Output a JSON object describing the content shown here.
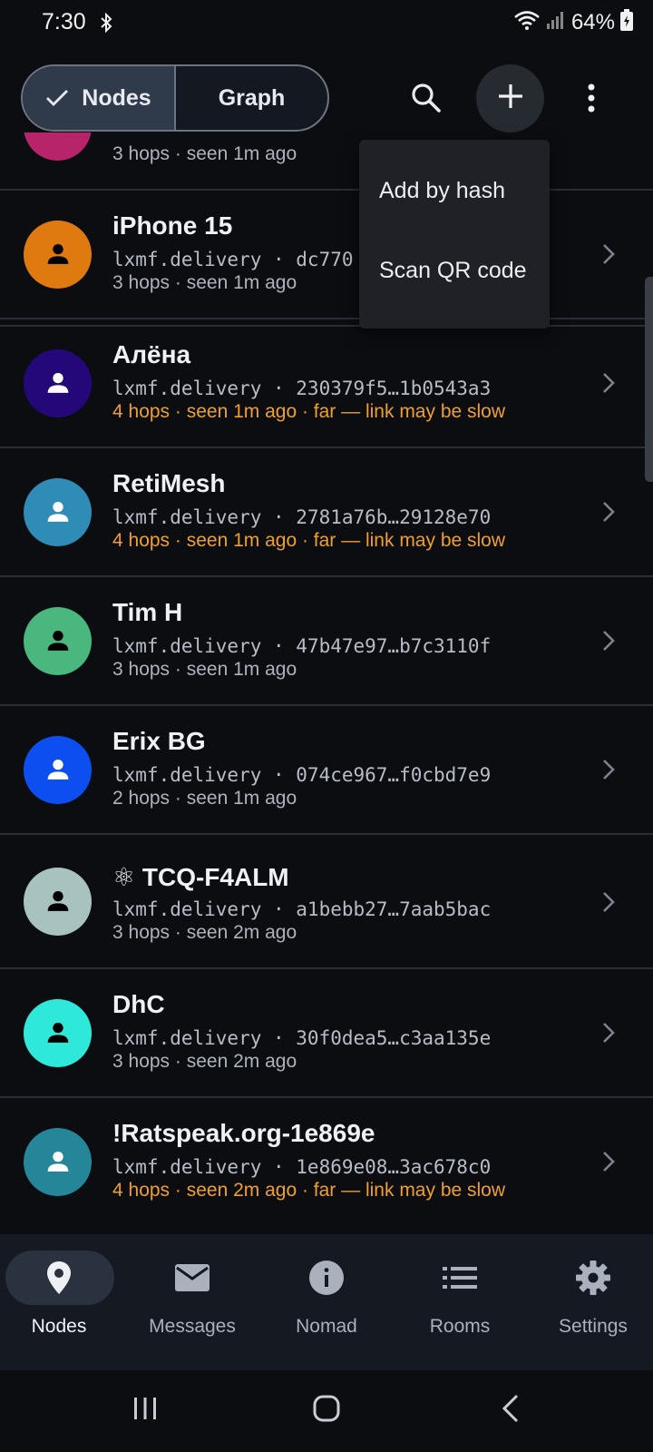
{
  "status_bar": {
    "time": "7:30",
    "battery": "64%"
  },
  "top_bar": {
    "segments": [
      {
        "label": "Nodes",
        "selected": true
      },
      {
        "label": "Graph",
        "selected": false
      }
    ],
    "icons": [
      "search-icon",
      "add-icon",
      "more-vert-icon"
    ]
  },
  "menu": {
    "items": [
      "Add by hash",
      "Scan QR code"
    ]
  },
  "rows": [
    {
      "name": "",
      "address": "",
      "meta": "3 hops · seen 1m ago",
      "far": false,
      "color": "#b8246a"
    },
    {
      "name": "iPhone 15",
      "address": "lxmf.delivery · dc770",
      "meta": "3 hops · seen 1m ago",
      "far": false,
      "color": "#df7a10"
    },
    {
      "name": "Алёна",
      "address": "lxmf.delivery · 230379f5…1b0543a3",
      "meta": "4 hops · seen 1m ago · far — link may be slow",
      "far": true,
      "color": "#24087a"
    },
    {
      "name": "RetiMesh",
      "address": "lxmf.delivery · 2781a76b…29128e70",
      "meta": "4 hops · seen 1m ago · far — link may be slow",
      "far": true,
      "color": "#2f8cb6"
    },
    {
      "name": "Tim H",
      "address": "lxmf.delivery · 47b47e97…b7c3110f",
      "meta": "3 hops · seen 1m ago",
      "far": false,
      "color": "#49b77e"
    },
    {
      "name": "Erix BG",
      "address": "lxmf.delivery · 074ce967…f0cbd7e9",
      "meta": "2 hops · seen 1m ago",
      "far": false,
      "color": "#0c4ef0"
    },
    {
      "name": "⚛ TCQ-F4ALM",
      "address": "lxmf.delivery · a1bebb27…7aab5bac",
      "meta": "3 hops · seen 2m ago",
      "far": false,
      "color": "#a8c3bf"
    },
    {
      "name": "DhC",
      "address": "lxmf.delivery · 30f0dea5…c3aa135e",
      "meta": "3 hops · seen 2m ago",
      "far": false,
      "color": "#2ee9d9"
    },
    {
      "name": "!Ratspeak.org-1e869e",
      "address": "lxmf.delivery · 1e869e08…3ac678c0",
      "meta": "4 hops · seen 2m ago · far — link may be slow",
      "far": true,
      "color": "#25869a"
    }
  ],
  "bottom_nav": [
    {
      "label": "Nodes",
      "icon": "location-pin-icon",
      "active": true
    },
    {
      "label": "Messages",
      "icon": "mail-icon",
      "active": false
    },
    {
      "label": "Nomad",
      "icon": "info-icon",
      "active": false
    },
    {
      "label": "Rooms",
      "icon": "list-icon",
      "active": false
    },
    {
      "label": "Settings",
      "icon": "gear-icon",
      "active": false
    }
  ],
  "colors": {
    "background": "#0c0d11",
    "warning_text": "#f0a02a",
    "nav_background": "#151922",
    "active_pill": "#2a3240"
  }
}
